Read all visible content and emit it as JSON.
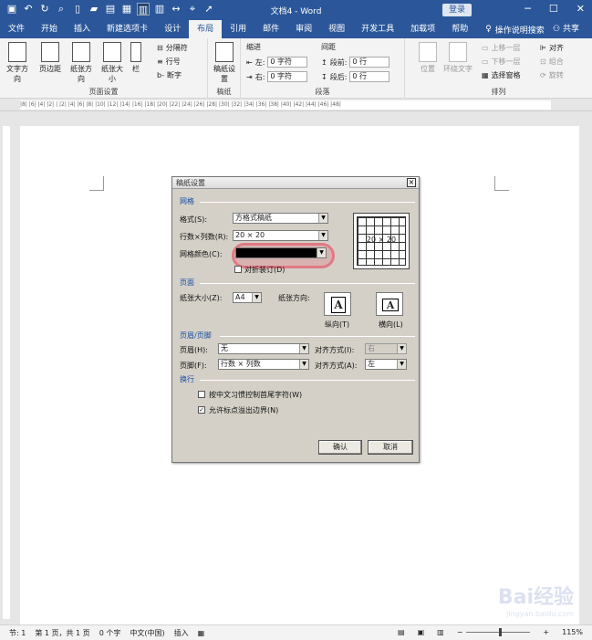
{
  "window": {
    "title": "文档4 - Word",
    "login_label": "登录",
    "controls": [
      "─",
      "☐",
      "✕"
    ]
  },
  "tabs": [
    "文件",
    "开始",
    "插入",
    "新建选项卡",
    "设计",
    "布局",
    "引用",
    "邮件",
    "审阅",
    "视图",
    "开发工具",
    "加载项",
    "帮助"
  ],
  "active_tab": "布局",
  "search_label": "操作说明搜索",
  "share_label": "共享",
  "ribbon": {
    "page_setup": {
      "buttons": [
        "文字方向",
        "页边距",
        "纸张方向",
        "纸张大小",
        "栏"
      ],
      "small": [
        "分隔符",
        "行号",
        "断字"
      ],
      "group_label": "页面设置"
    },
    "manuscript": {
      "button": "稿纸设置",
      "group_label": "稿纸"
    },
    "paragraph": {
      "indent_label": "缩进",
      "spacing_label": "间距",
      "left_label": "左:",
      "right_label": "右:",
      "before_label": "段前:",
      "after_label": "段后:",
      "left_value": "0 字符",
      "right_value": "0 字符",
      "before_value": "0 行",
      "after_value": "0 行",
      "group_label": "段落"
    },
    "arrange": {
      "buttons": [
        "位置",
        "环绕文字"
      ],
      "small": [
        "上移一层",
        "下移一层",
        "选择窗格",
        "对齐",
        "组合",
        "旋转"
      ],
      "group_label": "排列"
    }
  },
  "ruler_text": "|8| |6| |4| |2| | |2| |4| |6| |8| |10| |12| |14| |16| |18| |20| |22| |24| |26| |28| |30| |32| |34| |36| |38| |40| |42| |44| |46| |48|",
  "dialog": {
    "title": "稿纸设置",
    "close": "×",
    "grid_section": "网格",
    "format_label": "格式(S):",
    "format_value": "方格式稿纸",
    "rowcol_label": "行数×列数(R):",
    "rowcol_value": "20 × 20",
    "color_label": "网格颜色(C):",
    "fold_label": "对折装订(D)",
    "preview_label": "20 × 20",
    "page_section": "页面",
    "paper_size_label": "纸张大小(Z):",
    "paper_size_value": "A4",
    "orientation_label": "纸张方向:",
    "portrait_label": "纵向(T)",
    "landscape_label": "横向(L)",
    "hf_section": "页眉/页脚",
    "header_label": "页眉(H):",
    "header_value": "无",
    "header_align_label": "对齐方式(I):",
    "header_align_value": "右",
    "footer_label": "页脚(F):",
    "footer_value": "行数 × 列数",
    "footer_align_label": "对齐方式(A):",
    "footer_align_value": "左",
    "wrap_section": "换行",
    "opt1_label": "按中文习惯控制首尾字符(W)",
    "opt1_checked": false,
    "opt2_label": "允许标点溢出边界(N)",
    "opt2_checked": true,
    "ok_label": "确认",
    "cancel_label": "取消",
    "glyph": "A"
  },
  "status": {
    "section": "节: 1",
    "page": "第 1 页，共 1 页",
    "words": "0 个字",
    "language": "中文(中国)",
    "mode": "插入",
    "zoom": "115%"
  },
  "watermark": {
    "text": "Bai经验",
    "sub": "jingyan.baidu.com"
  }
}
